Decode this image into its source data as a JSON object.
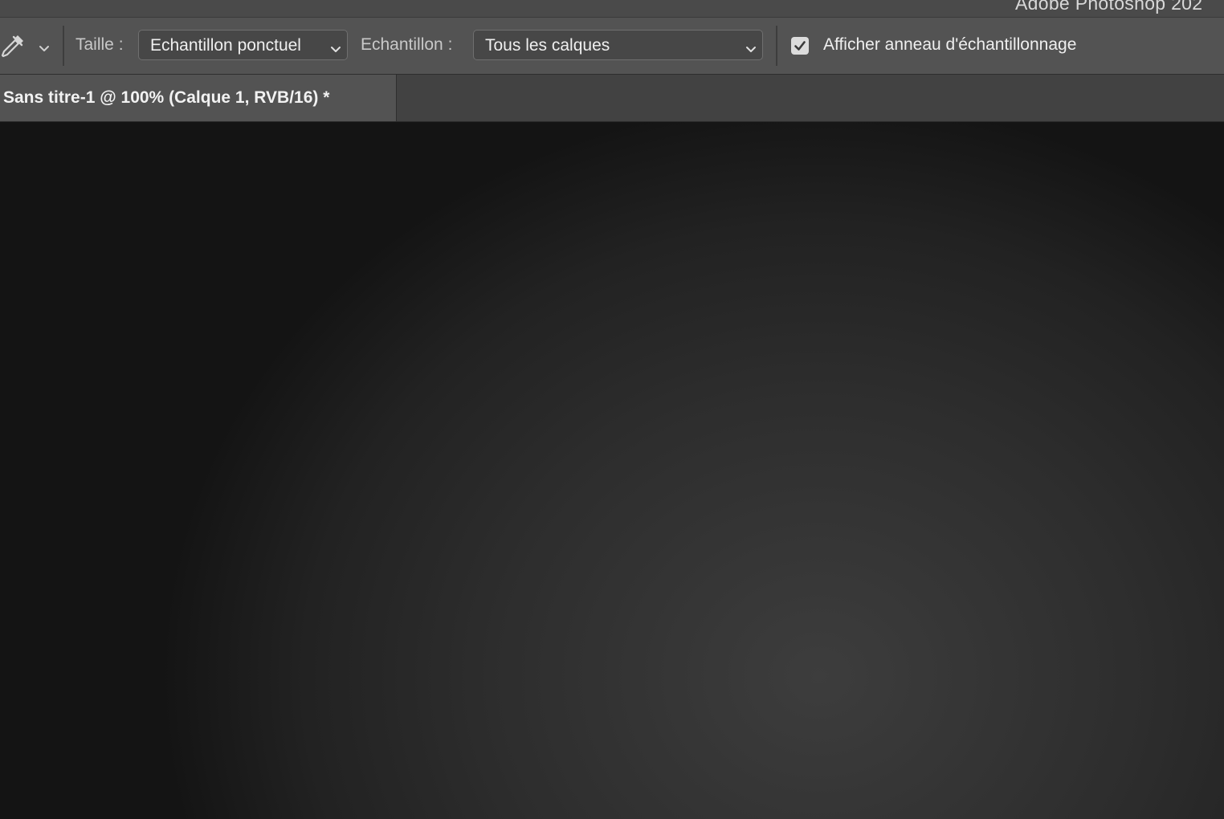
{
  "window": {
    "app_title": "Adobe Photoshop 202"
  },
  "options_bar": {
    "tool_icon": "eyedropper-icon",
    "size_label": "Taille :",
    "size_value": "Echantillon ponctuel",
    "sample_label": "Echantillon :",
    "sample_value": "Tous les calques",
    "show_ring_checked": true,
    "show_ring_label": "Afficher anneau d'échantillonnage"
  },
  "document": {
    "tab_title": "Sans titre-1 @ 100% (Calque 1, RVB/16) *"
  },
  "colors": {
    "toolbar_bg": "#535353",
    "tabbar_bg": "#424242",
    "canvas_center": "#3d3d3d",
    "canvas_edge": "#141414"
  }
}
